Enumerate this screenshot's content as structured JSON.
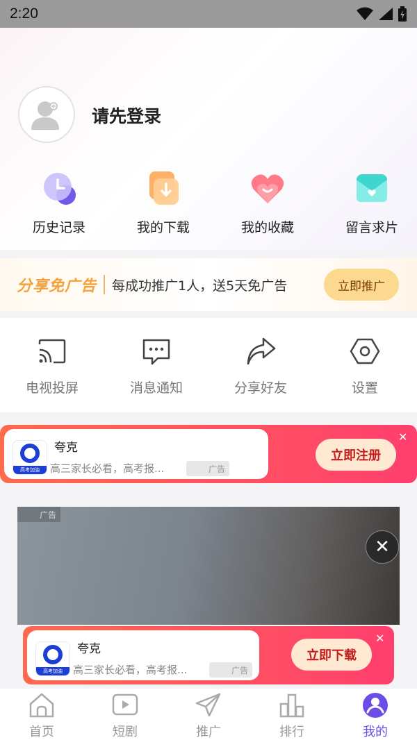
{
  "status": {
    "time": "2:20"
  },
  "profile": {
    "login_prompt": "请先登录"
  },
  "quick_actions": [
    {
      "label": "历史记录",
      "icon": "history-clock-icon"
    },
    {
      "label": "我的下载",
      "icon": "download-icon"
    },
    {
      "label": "我的收藏",
      "icon": "favorite-heart-icon"
    },
    {
      "label": "留言求片",
      "icon": "message-box-icon"
    }
  ],
  "promo": {
    "brand": "分享免广告",
    "text": "每成功推广1人，送5天免广告",
    "button": "立即推广"
  },
  "tools": [
    {
      "label": "电视投屏",
      "icon": "cast-icon"
    },
    {
      "label": "消息通知",
      "icon": "message-icon"
    },
    {
      "label": "分享好友",
      "icon": "share-icon"
    },
    {
      "label": "设置",
      "icon": "settings-icon"
    }
  ],
  "ad_top": {
    "name": "夸克",
    "desc": "高三家长必看，高考报...",
    "tag": "广告",
    "button": "立即注册",
    "logo_caption": "高考加油"
  },
  "ad_video": {
    "tag": "广告"
  },
  "ad_bottom": {
    "name": "夸克",
    "desc": "高三家长必看，高考报...",
    "tag": "广告",
    "button": "立即下载",
    "logo_caption": "高考加油"
  },
  "tabs": [
    {
      "label": "首页",
      "icon": "home-icon"
    },
    {
      "label": "短剧",
      "icon": "video-icon"
    },
    {
      "label": "推广",
      "icon": "send-icon"
    },
    {
      "label": "排行",
      "icon": "ranking-icon"
    },
    {
      "label": "我的",
      "icon": "profile-icon",
      "active": true
    }
  ],
  "colors": {
    "accent": "#6b4de6",
    "ad_gradient_start": "#ff6a4f",
    "ad_gradient_end": "#ff3f6e",
    "promo_brand": "#f5a23a"
  }
}
